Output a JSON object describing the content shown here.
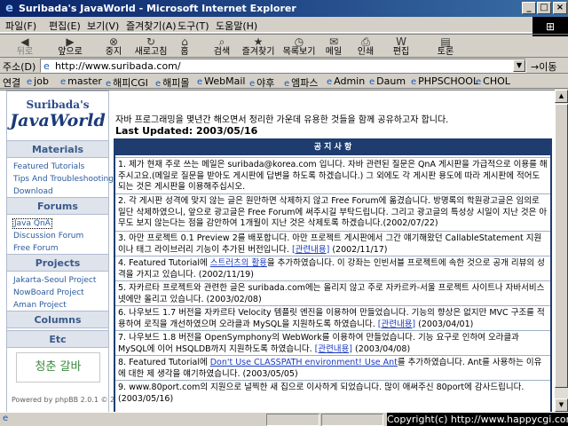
{
  "window": {
    "title": "Suribada's JavaWorld - Microsoft Internet Explorer",
    "minimize": "_",
    "maximize": "□",
    "close": "×"
  },
  "menubar": {
    "items": [
      "파일(F)",
      "편집(E)",
      "보기(V)",
      "즐겨찾기(A)",
      "도구(T)",
      "도움말(H)"
    ]
  },
  "toolbar": {
    "back": "뒤로",
    "forward": "앞으로",
    "stop": "중지",
    "refresh": "새로고침",
    "home": "홈",
    "search": "검색",
    "favorites": "즐겨찾기",
    "history": "목록보기",
    "mail": "메일",
    "print": "인쇄",
    "edit": "편집",
    "discuss": "토론"
  },
  "address": {
    "label": "주소(D)",
    "url": "http://www.suribada.com/",
    "go": "이동"
  },
  "links": {
    "label": "연결",
    "items": [
      "job",
      "master",
      "해피CGI",
      "해피몰",
      "WebMail",
      "야후",
      "엠파스",
      "Admin",
      "Daum",
      "PHPSCHOOL",
      "CHOL"
    ]
  },
  "sidebar": {
    "logo_line1": "Suribada's",
    "logo_line2": "JavaWorld",
    "sections": {
      "materials": "Materials",
      "forums": "Forums",
      "projects": "Projects",
      "columns": "Columns",
      "etc": "Etc"
    },
    "materials_links": [
      "Featured Tutorials",
      "Tips And Troubleshooting",
      "Download"
    ],
    "forums_links": [
      "Java QnA",
      "Discussion Forum",
      "Free Forum"
    ],
    "projects_links": [
      "Jakarta-Seoul Project",
      "NowBoard Project",
      "Aman Project"
    ],
    "badge": "청춘 갈바",
    "powered": "Powered by phpBB 2.0.1 © 2001"
  },
  "main": {
    "intro": "자바 프로그래밍을 몇년간 해오면서 정리한 가운데 유용한 것들을 함께 공유하고자 합니다.",
    "updated": "Last Updated: 2003/05/16",
    "notice_title": "공 지 사 항",
    "items": {
      "n1": "1. 제가 현재 주로 쓰는 메일은 suribada@korea.com 입니다. 자바 관련된 질문은 QnA 게시판을 가급적으로 이용를 해주시고요.(메일로 질문을 받아도 게시판에 답변을 하도록 하겠습니다.) 그 외에도 각 게시판 용도에 따라 게시판에 적어도 되는 것은 게시판을 이용해주십시오.",
      "n2": "2. 각 게시판 성격에 맞지 않는 글은 원만하면 삭제하지 않고 Free Forum에 옮겼습니다. 방명록의 학원광고글은 임의로 일단 삭제하였으니, 앞으로 광고글은 Free Forum에 써주시길 부탁드립니다. 그리고 광고글의 특성상 시일이 지난 것은 아무도 보지 않는다는 점을 감안하여 1개월이 지난 것은 삭제토록 하겠습니다.(2002/07/22)",
      "n3_a": "3. 아만 프로젝트 0.1 Preview 2를 배포합니다. 아만 프로젝트 게시판에서 그간 얘기해왔던 CallableStatement 지원이나 태그 라이브러리 기능이 추가된 버전입니다. ",
      "n3_link": "[관련내용]",
      "n3_b": " (2002/11/17)",
      "n4_a": "4. Featured Tutorial에 ",
      "n4_link": "스트러츠의 활용",
      "n4_b": "을 추가하였습니다. 이 강좌는 인빈서블 프로젝트에 속한 것으로 공개 리뷰의 성격을 가지고 있습니다. (2002/11/19)",
      "n5": "5. 자카르타 프로젝트와 관련한 글은 suribada.com에는 올리지 않고 주로 자카르카-서울 프로젝트 사이트나 자바서비스넷에만 올리고 있습니다. (2003/02/08)",
      "n6_a": "6. 나우보드 1.7 버전을 자카르타 Velocity 템플릿 엔진을 이용하여 만들었습니다. 기능의 향상은 없지만 MVC 구조를 적용하여 로직을 개선하였으며 오라클과 MySQL을 지원하도록 하였습니다. ",
      "n6_link": "[관련내용]",
      "n6_b": " (2003/04/01)",
      "n7_a": "7. 나우보드 1.8 버전을 OpenSymphony의 WebWork를 이용하여 만들었습니다. 기능 요구로 인하여 오라클과 MySQL에 이어 HSQLDB까지 지원하도록 하였습니다. ",
      "n7_link": "[관련내용]",
      "n7_b": " (2003/04/08)",
      "n8_a": "8. Featured Tutorial에 ",
      "n8_link": "Don't Use CLASSPATH environment! Use Ant",
      "n8_b": "를 추가하였습니다. Ant를 사용하는 이유에 대한 제 생각을 얘기하였습니다. (2003/05/05)",
      "n9": "9. www.80port.com의 지원으로 널찍한 새 집으로 이사하게 되었습니다. 많이 애써주신 80port에 감사드립니다. (2003/05/16)"
    }
  },
  "statusbar": {
    "copyright": "Copyright(c) http://www.happycgi.com"
  },
  "colors": {
    "title_start": "#0a246a",
    "title_end": "#3a6ea5",
    "notice_header": "#1e3d6e",
    "sidebar_section_bg": "#dee3ec",
    "link": "#2a5aa0"
  },
  "icons": {
    "back": "back-arrow-icon",
    "forward": "forward-arrow-icon",
    "stop": "stop-icon",
    "refresh": "refresh-icon",
    "home": "home-icon",
    "search": "search-icon",
    "favorites": "favorites-icon",
    "history": "history-icon",
    "mail": "mail-icon",
    "print": "print-icon",
    "edit": "edit-icon",
    "discuss": "discuss-icon"
  }
}
